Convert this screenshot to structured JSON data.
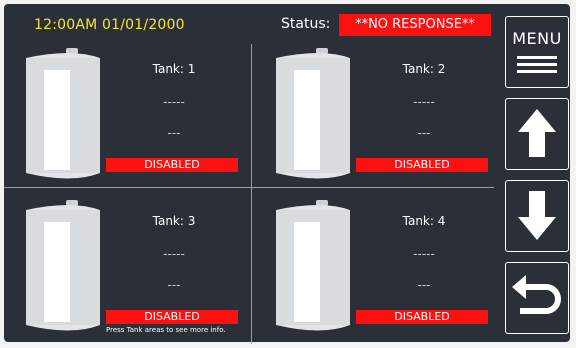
{
  "header": {
    "clock": "12:00AM 01/01/2000",
    "status_label": "Status:",
    "status_value": "**NO RESPONSE**",
    "status_color": "#ff1010",
    "clock_color": "#f4e72e"
  },
  "tanks": [
    {
      "name": "Tank: 1",
      "line1": "-----",
      "line2": "---",
      "state": "DISABLED"
    },
    {
      "name": "Tank: 2",
      "line1": "-----",
      "line2": "---",
      "state": "DISABLED"
    },
    {
      "name": "Tank: 3",
      "line1": "-----",
      "line2": "---",
      "state": "DISABLED"
    },
    {
      "name": "Tank: 4",
      "line1": "-----",
      "line2": "---",
      "state": "DISABLED"
    }
  ],
  "hint": "Press Tank areas to see more info.",
  "sidebar": {
    "menu_label": "MENU",
    "up_icon": "arrow-up-icon",
    "down_icon": "arrow-down-icon",
    "back_icon": "return-icon"
  }
}
